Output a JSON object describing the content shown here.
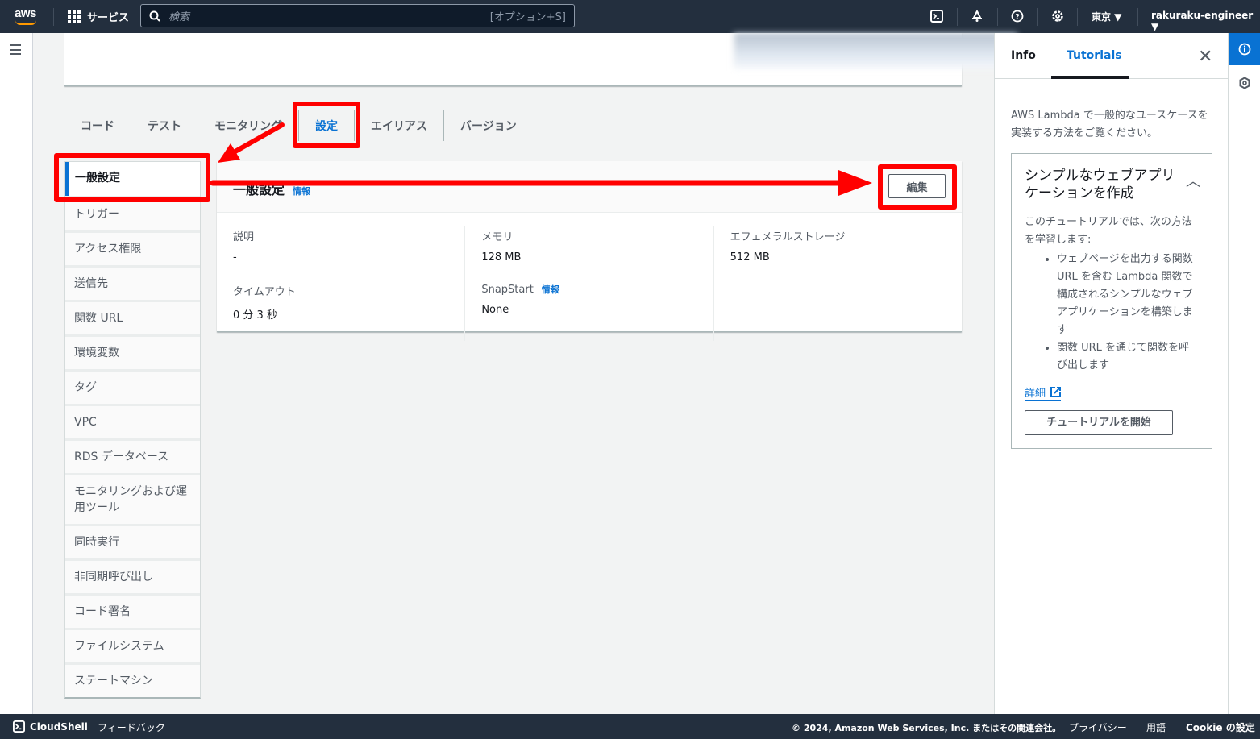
{
  "topbar": {
    "logo": "aws",
    "services_label": "サービス",
    "search_placeholder": "検索",
    "search_shortcut": "[オプション+S]",
    "region": "東京 ▼",
    "account": "rakuraku-engineer ▼",
    "icons": [
      "cloudshell-icon",
      "notifications-icon",
      "help-icon",
      "settings-icon"
    ]
  },
  "tabs": [
    {
      "label": "コード",
      "active": false
    },
    {
      "label": "テスト",
      "active": false
    },
    {
      "label": "モニタリング",
      "active": false
    },
    {
      "label": "設定",
      "active": true
    },
    {
      "label": "エイリアス",
      "active": false
    },
    {
      "label": "バージョン",
      "active": false
    }
  ],
  "sidenav": [
    "一般設定",
    "トリガー",
    "アクセス権限",
    "送信先",
    "関数 URL",
    "環境変数",
    "タグ",
    "VPC",
    "RDS データベース",
    "モニタリングおよび運用ツール",
    "同時実行",
    "非同期呼び出し",
    "コード署名",
    "ファイルシステム",
    "ステートマシン"
  ],
  "general": {
    "title": "一般設定",
    "info_link": "情報",
    "edit_label": "編集",
    "description_label": "説明",
    "description_value": "-",
    "timeout_label": "タイムアウト",
    "timeout_value": "0 分 3 秒",
    "memory_label": "メモリ",
    "memory_value": "128 MB",
    "snapstart_label": "SnapStart",
    "snapstart_info": "情報",
    "snapstart_value": "None",
    "ephemeral_label": "エフェメラルストレージ",
    "ephemeral_value": "512 MB"
  },
  "help_panel": {
    "tab_info": "Info",
    "tab_tutorials": "Tutorials",
    "description": "AWS Lambda で一般的なユースケースを実装する方法をご覧ください。",
    "tutorial": {
      "title": "シンプルなウェブアプリケーションを作成",
      "intro": "このチュートリアルでは、次の方法を学習します:",
      "bullets": [
        "ウェブページを出力する関数 URL を含む Lambda 関数で構成されるシンプルなウェブアプリケーションを構築します",
        "関数 URL を通じて関数を呼び出します"
      ],
      "detail_link": "詳細",
      "start_label": "チュートリアルを開始"
    }
  },
  "footer": {
    "cloudshell": "CloudShell",
    "feedback": "フィードバック",
    "copyright": "© 2024, Amazon Web Services, Inc. またはその関連会社。",
    "privacy": "プライバシー",
    "terms": "用語",
    "cookie": "Cookie の設定"
  },
  "annotation_color": "#ff0000",
  "accent_color": "#0972d3"
}
